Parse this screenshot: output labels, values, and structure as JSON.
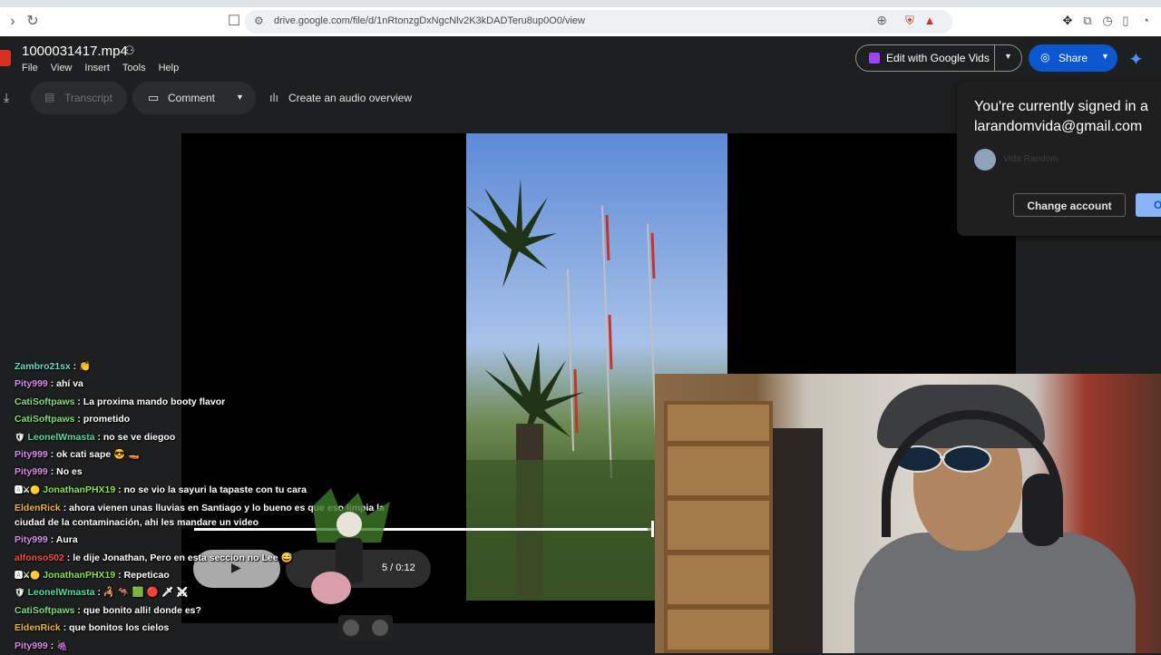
{
  "browser": {
    "url": "drive.google.com/file/d/1nRtonzgDxNgcNlv2K3kDADTeru8up0O0/view"
  },
  "drive": {
    "file_title": "1000031417.mp4",
    "menu": [
      "File",
      "View",
      "Insert",
      "Tools",
      "Help"
    ],
    "vids_button": "Edit with Google Vids",
    "share_button": "Share",
    "transcript_button": "Transcript",
    "comment_button": "Comment",
    "audio_overview_button": "Create an audio overview"
  },
  "player": {
    "time_display": "5 / 0:12",
    "progress_fraction": 0.99
  },
  "account_popup": {
    "line1": "You're currently signed in a",
    "email": "larandomvida@gmail.com",
    "account_name": "Vida Random",
    "change_button": "Change account",
    "ok_button": "O"
  },
  "chat": [
    {
      "user": "Zambro21sx",
      "color": "#5ee0c8",
      "msg": "👏",
      "badges": ""
    },
    {
      "user": "Pity999",
      "color": "#d98cf0",
      "msg": "ahí va",
      "badges": ""
    },
    {
      "user": "CatiSoftpaws",
      "color": "#7be07b",
      "msg": "La proxima mando booty flavor",
      "badges": ""
    },
    {
      "user": "CatiSoftpaws",
      "color": "#7be07b",
      "msg": "prometido",
      "badges": ""
    },
    {
      "user": "LeonelWmasta",
      "color": "#4fe0a0",
      "msg": "no se ve diegoo",
      "badges": "🛡"
    },
    {
      "user": "Pity999",
      "color": "#d98cf0",
      "msg": "ok cati sape 😎 🚤",
      "badges": ""
    },
    {
      "user": "Pity999",
      "color": "#d98cf0",
      "msg": "No es",
      "badges": ""
    },
    {
      "user": "JonathanPHX19",
      "color": "#8be34a",
      "msg": "no se vio la sayuri la tapaste con tu cara",
      "badges": "🅰⚔🟡"
    },
    {
      "user": "EldenRick",
      "color": "#f0b43c",
      "msg": "ahora vienen unas lluvias en Santiago y lo bueno es que eso limpia la ciudad de la contaminación, ahi les mandare un video",
      "badges": "",
      "wrap": true
    },
    {
      "user": "Pity999",
      "color": "#d98cf0",
      "msg": "Aura",
      "badges": ""
    },
    {
      "user": "alfonso502",
      "color": "#ff4b3e",
      "msg": "le dije Jonathan, Pero en esta seccion no Lee 😅",
      "badges": ""
    },
    {
      "user": "JonathanPHX19",
      "color": "#8be34a",
      "msg": "Repeticao",
      "badges": "🅰⚔🟡"
    },
    {
      "user": "LeonelWmasta",
      "color": "#4fe0a0",
      "msg": "🦂 🦘 🟩 🔴 🗡 ⚔",
      "badges": "🛡"
    },
    {
      "user": "CatiSoftpaws",
      "color": "#7be07b",
      "msg": "que bonito alli! donde es?",
      "badges": ""
    },
    {
      "user": "EldenRick",
      "color": "#f0b43c",
      "msg": "que bonitos los cielos",
      "badges": ""
    },
    {
      "user": "Pity999",
      "color": "#d98cf0",
      "msg": "🍇",
      "badges": ""
    }
  ]
}
